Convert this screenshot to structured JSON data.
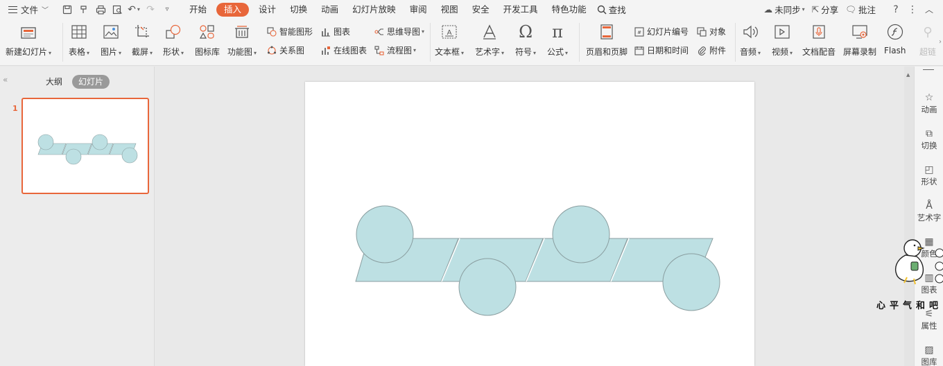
{
  "menubar": {
    "file_label": "文件",
    "tabs": [
      "开始",
      "插入",
      "设计",
      "切换",
      "动画",
      "幻灯片放映",
      "审阅",
      "视图",
      "安全",
      "开发工具",
      "特色功能"
    ],
    "active_tab": "插入",
    "search_label": "查找",
    "sync_label": "未同步",
    "share_label": "分享",
    "comment_label": "批注"
  },
  "ribbon": {
    "new_slide": "新建幻灯片",
    "table": "表格",
    "picture": "图片",
    "screenshot": "截屏",
    "shape": "形状",
    "icon_lib": "图标库",
    "func_chart": "功能图",
    "smart_shape": "智能图形",
    "chart": "图表",
    "relation": "关系图",
    "online_chart": "在线图表",
    "mindmap": "思维导图",
    "flowchart": "流程图",
    "textbox": "文本框",
    "wordart": "艺术字",
    "symbol": "符号",
    "formula": "公式",
    "header_footer": "页眉和页脚",
    "slide_number": "幻灯片编号",
    "object": "对象",
    "date_time": "日期和时间",
    "attachment": "附件",
    "audio": "音频",
    "video": "视频",
    "doc_dub": "文档配音",
    "screen_record": "屏幕录制",
    "flash": "Flash",
    "hyperlink": "超链"
  },
  "leftpanel": {
    "outline_tab": "大纲",
    "slides_tab": "幻灯片",
    "slide_number": "1"
  },
  "rsidebar": {
    "items": [
      "动画",
      "切换",
      "形状",
      "艺术字",
      "颜色",
      "图表",
      "属性",
      "图库"
    ]
  },
  "watermark_text": "心平气和吧",
  "colors": {
    "accent": "#e8663a",
    "shape_fill": "#bde0e3",
    "shape_stroke": "#8a9ea0"
  }
}
